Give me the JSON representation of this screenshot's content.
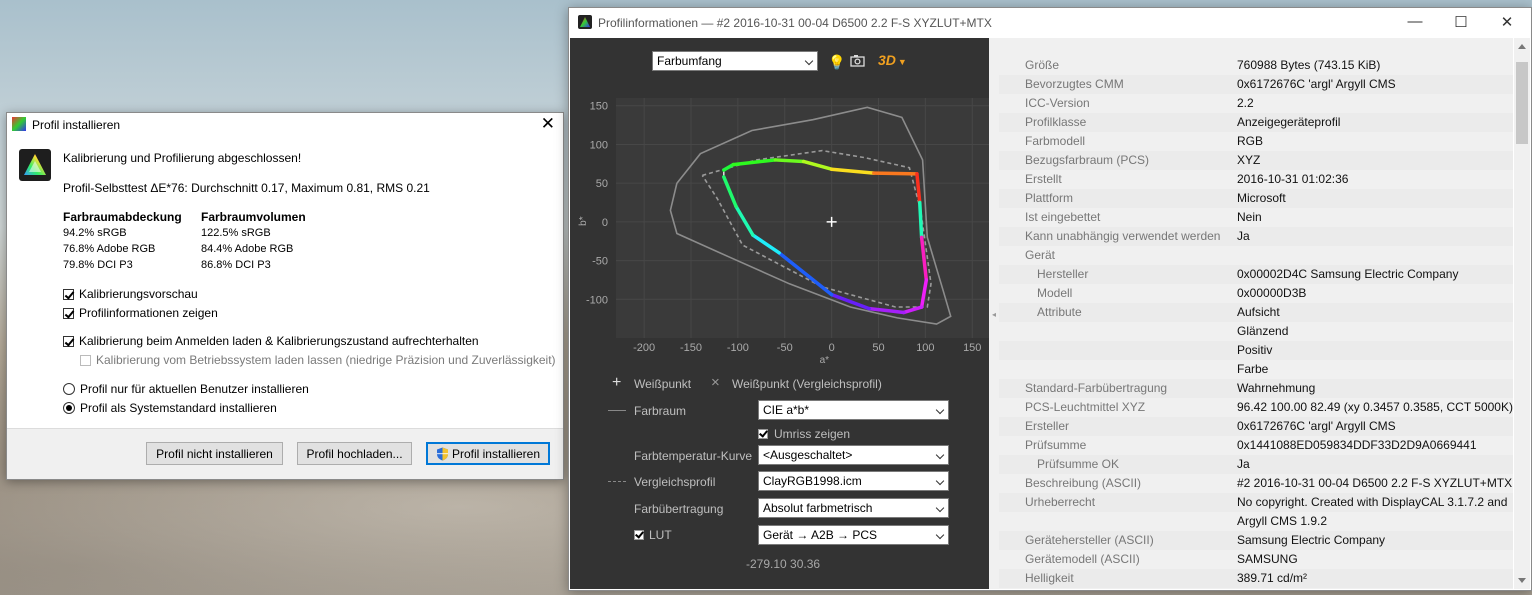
{
  "install_dialog": {
    "title": "Profil installieren",
    "close": "✕",
    "message": "Kalibrierung und Profilierung abgeschlossen!",
    "selftest": "Profil-Selbsttest ΔE*76: Durchschnitt 0.17, Maximum 0.81, RMS 0.21",
    "coverage": {
      "heading": "Farbraumabdeckung",
      "lines": [
        "94.2% sRGB",
        "76.8% Adobe RGB",
        "79.8% DCI P3"
      ]
    },
    "volume": {
      "heading": "Farbraumvolumen",
      "lines": [
        "122.5% sRGB",
        "84.4% Adobe RGB",
        "86.8% DCI P3"
      ]
    },
    "checkboxes": [
      {
        "label": "Kalibrierungsvorschau",
        "checked": true,
        "enabled": true
      },
      {
        "label": "Profilinformationen zeigen",
        "checked": true,
        "enabled": true
      },
      {
        "label": "Kalibrierung beim Anmelden laden & Kalibrierungszustand aufrechterhalten",
        "checked": true,
        "enabled": true
      },
      {
        "label": "Kalibrierung vom Betriebssystem laden lassen (niedrige Präzision und Zuverlässigkeit)",
        "checked": false,
        "enabled": false
      }
    ],
    "radios": [
      {
        "label": "Profil nur für aktuellen Benutzer installieren",
        "selected": false
      },
      {
        "label": "Profil als Systemstandard installieren",
        "selected": true
      }
    ],
    "buttons": {
      "dont_install": "Profil nicht installieren",
      "upload": "Profil hochladen...",
      "install": "Profil installieren"
    }
  },
  "profile_window": {
    "title": "Profilinformationen — #2 2016-10-31 00-04 D6500 2.2 F-S XYZLUT+MTX",
    "controls": {
      "minimize": "—",
      "maximize": "☐",
      "close": "✕"
    },
    "view_select": "Farbumfang",
    "toolbar_3d": "3D",
    "legend": {
      "whitepoint": "Weißpunkt",
      "whitepoint_ref": "Weißpunkt (Vergleichsprofil)"
    },
    "settings": [
      {
        "label": "Farbraum",
        "value": "CIE a*b*"
      },
      {
        "label": "Farbtemperatur-Kurve",
        "value": "<Ausgeschaltet>"
      },
      {
        "label": "Vergleichsprofil",
        "value": "ClayRGB1998.icm"
      },
      {
        "label": "Farbübertragung",
        "value": "Absolut farbmetrisch"
      },
      {
        "label": "LUT",
        "value": "Gerät → A2B → PCS"
      }
    ],
    "outline_checkbox": "Umriss zeigen",
    "cursor_readout": "-279.10 30.36",
    "info_rows": [
      {
        "k": "Größe",
        "v": "760988 Bytes (743.15 KiB)",
        "indent": false
      },
      {
        "k": "Bevorzugtes CMM",
        "v": "0x6172676C 'argl' Argyll CMS",
        "indent": false
      },
      {
        "k": "ICC-Version",
        "v": "2.2",
        "indent": false
      },
      {
        "k": "Profilklasse",
        "v": "Anzeigegeräteprofil",
        "indent": false
      },
      {
        "k": "Farbmodell",
        "v": "RGB",
        "indent": false
      },
      {
        "k": "Bezugsfarbraum (PCS)",
        "v": "XYZ",
        "indent": false
      },
      {
        "k": "Erstellt",
        "v": "2016-10-31 01:02:36",
        "indent": false
      },
      {
        "k": "Plattform",
        "v": "Microsoft",
        "indent": false
      },
      {
        "k": "Ist eingebettet",
        "v": "Nein",
        "indent": false
      },
      {
        "k": "Kann unabhängig verwendet werden",
        "v": "Ja",
        "indent": false
      },
      {
        "k": "Gerät",
        "v": "",
        "indent": false
      },
      {
        "k": "Hersteller",
        "v": "0x00002D4C Samsung Electric Company",
        "indent": true
      },
      {
        "k": "Modell",
        "v": "0x00000D3B",
        "indent": true
      },
      {
        "k": "Attribute",
        "v": "Aufsicht",
        "indent": true
      },
      {
        "k": "",
        "v": "Glänzend",
        "indent": false
      },
      {
        "k": "",
        "v": "Positiv",
        "indent": false
      },
      {
        "k": "",
        "v": "Farbe",
        "indent": false
      },
      {
        "k": "Standard-Farbübertragung",
        "v": "Wahrnehmung",
        "indent": false
      },
      {
        "k": "PCS-Leuchtmittel XYZ",
        "v": "96.42 100.00  82.49 (xy 0.3457 0.3585, CCT 5000K)",
        "indent": false
      },
      {
        "k": "Ersteller",
        "v": "0x6172676C 'argl' Argyll CMS",
        "indent": false
      },
      {
        "k": "Prüfsumme",
        "v": "0x1441088ED059834DDF33D2D9A0669441",
        "indent": false
      },
      {
        "k": "Prüfsumme OK",
        "v": "Ja",
        "indent": true
      },
      {
        "k": "Beschreibung (ASCII)",
        "v": "#2 2016-10-31 00-04 D6500 2.2 F-S XYZLUT+MTX",
        "indent": false
      },
      {
        "k": "Urheberrecht",
        "v": "No copyright. Created with DisplayCAL 3.1.7.2 and",
        "indent": false
      },
      {
        "k": "",
        "v": "Argyll CMS 1.9.2",
        "indent": false
      },
      {
        "k": "Gerätehersteller (ASCII)",
        "v": "Samsung Electric Company",
        "indent": false
      },
      {
        "k": "Gerätemodell (ASCII)",
        "v": "SAMSUNG",
        "indent": false
      },
      {
        "k": "Helligkeit",
        "v": "389.71 cd/m²",
        "indent": false
      }
    ]
  },
  "chart_data": {
    "type": "line",
    "title": "",
    "xlabel": "a*",
    "ylabel": "b*",
    "xlim": [
      -230,
      170
    ],
    "ylim": [
      -150,
      160
    ],
    "x_ticks": [
      -200,
      -150,
      -100,
      -50,
      0,
      50,
      100,
      150
    ],
    "y_ticks": [
      150,
      100,
      50,
      0,
      -50,
      -100
    ],
    "grid": true,
    "series": [
      {
        "name": "",
        "style": "gradient-solid",
        "points": [
          [
            -115,
            67
          ],
          [
            -105,
            74
          ],
          [
            -60,
            80
          ],
          [
            -30,
            78
          ],
          [
            0,
            68
          ],
          [
            45,
            63
          ],
          [
            91,
            62
          ],
          [
            94,
            25
          ],
          [
            96,
            -20
          ],
          [
            101,
            -75
          ],
          [
            96,
            -110
          ],
          [
            77,
            -117
          ],
          [
            40,
            -112
          ],
          [
            0,
            -94
          ],
          [
            -56,
            -40
          ],
          [
            -84,
            -17
          ],
          [
            -102,
            20
          ],
          [
            -115,
            58
          ]
        ]
      },
      {
        "name": "",
        "style": "gray-dashed",
        "points": [
          [
            -138,
            60
          ],
          [
            -80,
            80
          ],
          [
            -10,
            92
          ],
          [
            35,
            83
          ],
          [
            83,
            70
          ],
          [
            95,
            15
          ],
          [
            106,
            -80
          ],
          [
            102,
            -110
          ],
          [
            68,
            -110
          ],
          [
            -10,
            -84
          ],
          [
            -95,
            -30
          ],
          [
            -122,
            30
          ],
          [
            -138,
            60
          ]
        ]
      },
      {
        "name": "",
        "style": "gray-solid",
        "points": [
          [
            -165,
            50
          ],
          [
            -140,
            88
          ],
          [
            -85,
            118
          ],
          [
            -20,
            132
          ],
          [
            38,
            148
          ],
          [
            75,
            135
          ],
          [
            97,
            80
          ],
          [
            102,
            -20
          ],
          [
            118,
            -85
          ],
          [
            127,
            -122
          ],
          [
            112,
            -132
          ],
          [
            70,
            -124
          ],
          [
            20,
            -110
          ],
          [
            -45,
            -80
          ],
          [
            -110,
            -45
          ],
          [
            -165,
            -15
          ],
          [
            -172,
            15
          ],
          [
            -165,
            50
          ]
        ]
      }
    ],
    "whitepoint": [
      0,
      0
    ]
  }
}
